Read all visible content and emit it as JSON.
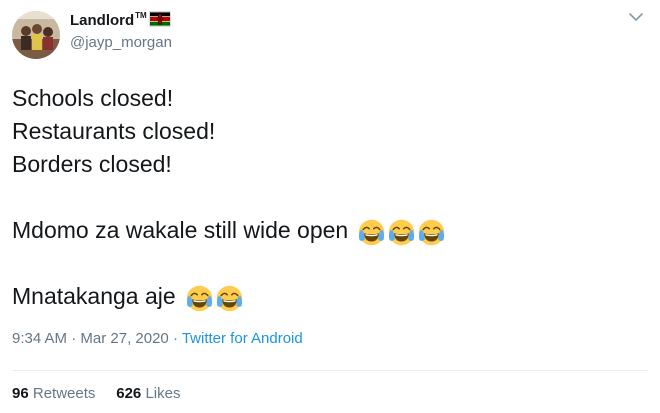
{
  "author": {
    "display_name": "Landlord",
    "tm": "TM",
    "flag_icon": "kenya-flag-icon",
    "handle": "@jayp_morgan"
  },
  "tweet": {
    "lines": [
      "Schools closed!",
      "Restaurants closed!",
      "Borders closed!",
      "Mdomo za wakale still wide open",
      "Mnatakanga aje"
    ],
    "emoji_icon": "face-with-tears-of-joy-icon"
  },
  "meta": {
    "time": "9:34 AM",
    "sep1": " · ",
    "date": "Mar 27, 2020",
    "sep2": " · ",
    "source": "Twitter for Android"
  },
  "stats": {
    "retweets_count": "96",
    "retweets_label": "Retweets",
    "likes_count": "626",
    "likes_label": "Likes"
  },
  "colors": {
    "text": "#14171a",
    "secondary": "#657786",
    "link": "#1b95e0",
    "divider": "#e6ecf0"
  }
}
